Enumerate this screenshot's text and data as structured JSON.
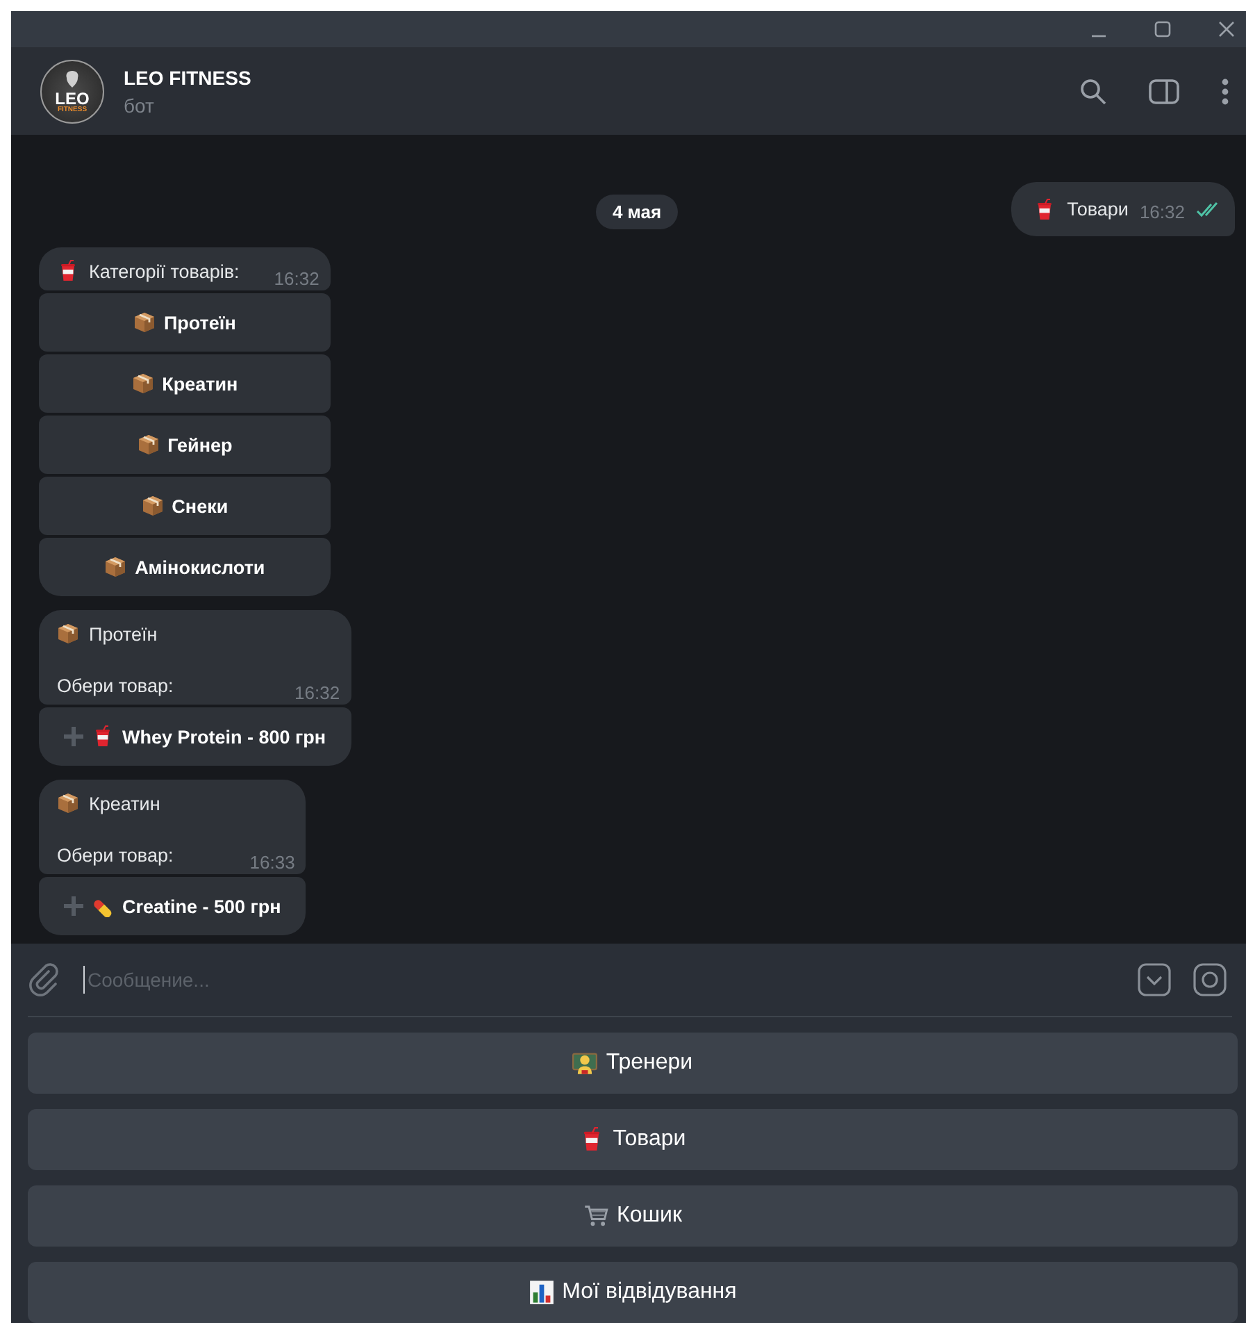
{
  "header": {
    "avatar": {
      "line1": "LEO",
      "line2": "FITNESS"
    },
    "title": "LEO FITNESS",
    "subtitle": "бот"
  },
  "date_badge": "4 мая",
  "messages": [
    {
      "kind": "outgoing",
      "text": "Товари",
      "time": "16:32",
      "read": true
    },
    {
      "kind": "incoming",
      "paragraphs": [
        "Категорії товарів:"
      ],
      "time": "16:32",
      "buttons": [
        {
          "label": "Протеїн",
          "add": false
        },
        {
          "label": "Креатин",
          "add": false
        },
        {
          "label": "Гейнер",
          "add": false
        },
        {
          "label": "Снеки",
          "add": false
        },
        {
          "label": "Амінокислоти",
          "add": false
        }
      ]
    },
    {
      "kind": "incoming",
      "paragraphs": [
        "Протеїн",
        "Обери товар:"
      ],
      "time": "16:32",
      "buttons": [
        {
          "label": "Whey Protein - 800 грн",
          "add": true
        }
      ]
    },
    {
      "kind": "incoming",
      "paragraphs": [
        "Креатин",
        "Обери товар:"
      ],
      "time": "16:33",
      "buttons": [
        {
          "label": "Creatine - 500 грн",
          "add": true
        }
      ]
    }
  ],
  "composer": {
    "placeholder": "Сообщение..."
  },
  "keyboard": [
    {
      "label": "Тренери"
    },
    {
      "label": "Товари"
    },
    {
      "label": "Кошик"
    },
    {
      "label": "Мої відвідування"
    }
  ]
}
